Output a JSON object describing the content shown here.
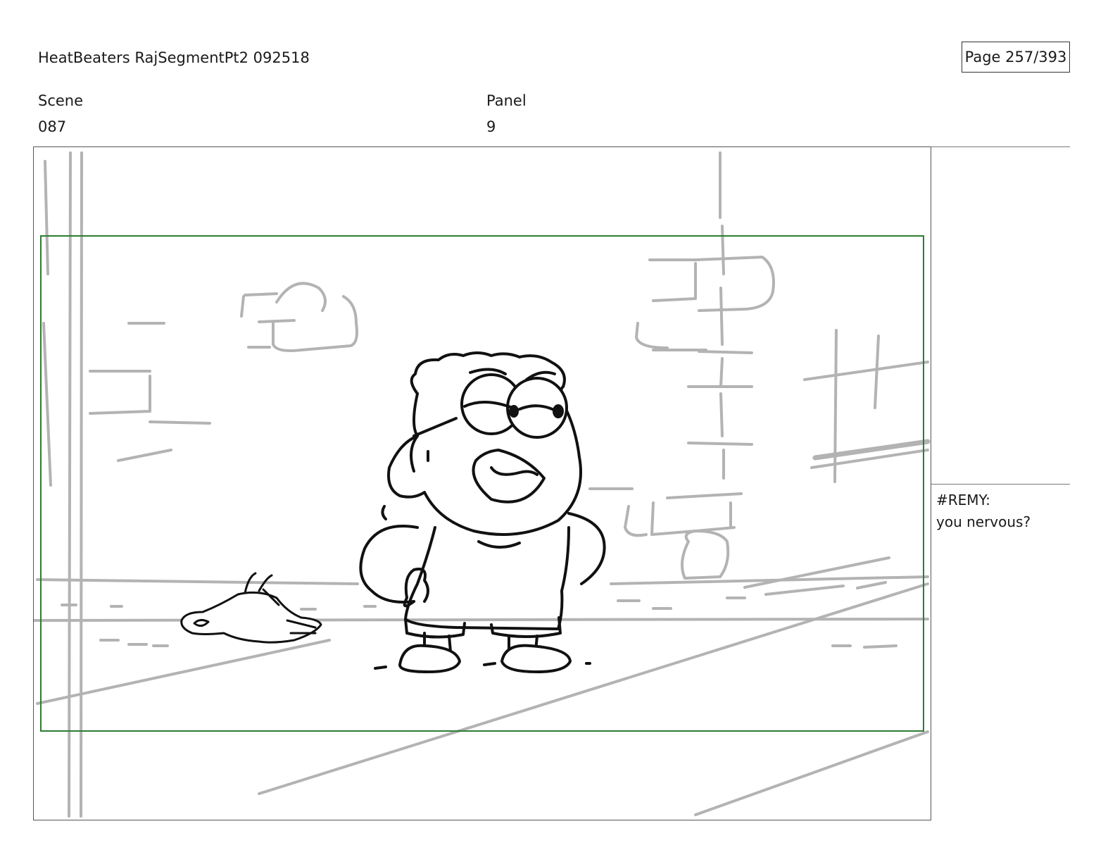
{
  "header": {
    "title": "HeatBeaters RajSegmentPt2 092518",
    "page_counter": "Page 257/393"
  },
  "meta": {
    "scene_label": "Scene",
    "scene_value": "087",
    "panel_label": "Panel",
    "panel_value": "9"
  },
  "dialogue": {
    "speaker": "#REMY:",
    "line": "you nervous?"
  },
  "colors": {
    "safe_area": "#2e7d32",
    "background_lines": "#b3b3b3",
    "character_lines": "#111111"
  }
}
